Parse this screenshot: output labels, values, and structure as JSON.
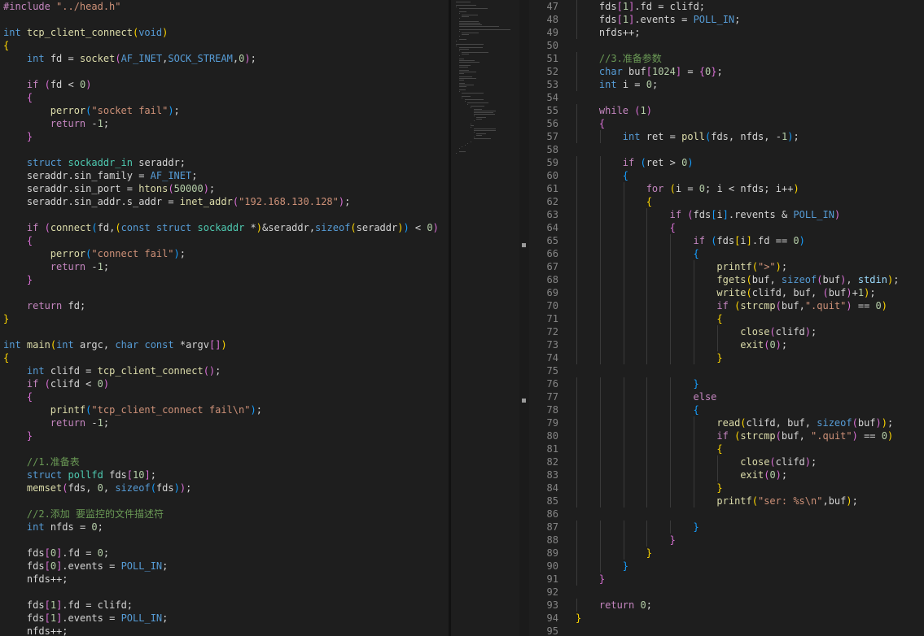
{
  "left_editor": {
    "lines": [
      "#include \"../head.h\"",
      "",
      "int tcp_client_connect(void)",
      "{",
      "    int fd = socket(AF_INET,SOCK_STREAM,0);",
      "",
      "    if (fd < 0)",
      "    {",
      "        perror(\"socket fail\");",
      "        return -1;",
      "    }",
      "",
      "    struct sockaddr_in seraddr;",
      "    seraddr.sin_family = AF_INET;",
      "    seraddr.sin_port = htons(50000);",
      "    seraddr.sin_addr.s_addr = inet_addr(\"192.168.130.128\");",
      "",
      "    if (connect(fd,(const struct sockaddr *)&seraddr,sizeof(seraddr)) < 0)",
      "    {",
      "        perror(\"connect fail\");",
      "        return -1;",
      "    }",
      "",
      "    return fd;",
      "}",
      "",
      "int main(int argc, char const *argv[])",
      "{",
      "    int clifd = tcp_client_connect();",
      "    if (clifd < 0)",
      "    {",
      "        printf(\"tcp_client_connect fail\\n\");",
      "        return -1;",
      "    }",
      "",
      "    //1.准备表",
      "    struct pollfd fds[10];",
      "    memset(fds, 0, sizeof(fds));",
      "",
      "    //2.添加 要监控的文件描述符",
      "    int nfds = 0;",
      "",
      "    fds[0].fd = 0;",
      "    fds[0].events = POLL_IN;",
      "    nfds++;",
      "",
      "    fds[1].fd = clifd;",
      "    fds[1].events = POLL_IN;",
      "    nfds++;"
    ]
  },
  "right_editor": {
    "line_numbers": [
      "47",
      "48",
      "49",
      "50",
      "51",
      "52",
      "53",
      "54",
      "55",
      "56",
      "57",
      "58",
      "59",
      "60",
      "61",
      "62",
      "63",
      "64",
      "65",
      "66",
      "67",
      "68",
      "69",
      "70",
      "71",
      "72",
      "73",
      "74",
      "75",
      "76",
      "77",
      "78",
      "79",
      "80",
      "81",
      "82",
      "83",
      "84",
      "85",
      "86",
      "87",
      "88",
      "89",
      "90",
      "91",
      "92",
      "93",
      "94",
      "95"
    ],
    "lines": [
      "    fds[1].fd = clifd;",
      "    fds[1].events = POLL_IN;",
      "    nfds++;",
      "",
      "    //3.准备参数",
      "    char buf[1024] = {0};",
      "    int i = 0;",
      "",
      "    while (1)",
      "    {",
      "        int ret = poll(fds, nfds, -1);",
      "",
      "        if (ret > 0)",
      "        {",
      "            for (i = 0; i < nfds; i++)",
      "            {",
      "                if (fds[i].revents & POLL_IN)",
      "                {",
      "                    if (fds[i].fd == 0)",
      "                    {",
      "                        printf(\">\");",
      "                        fgets(buf, sizeof(buf), stdin);",
      "                        write(clifd, buf, (buf)+1);",
      "                        if (strcmp(buf,\".quit\") == 0)",
      "                        {",
      "                            close(clifd);",
      "                            exit(0);",
      "                        }",
      "",
      "                    }",
      "                    else",
      "                    {",
      "                        read(clifd, buf, sizeof(buf));",
      "                        if (strcmp(buf, \".quit\") == 0)",
      "                        {",
      "                            close(clifd);",
      "                            exit(0);",
      "                        }",
      "                        printf(\"ser: %s\\n\",buf);",
      "",
      "                    }",
      "                }",
      "            }",
      "        }",
      "    }",
      "",
      "    return 0;",
      "}",
      ""
    ]
  },
  "colors": {
    "background": "#1e1e1e",
    "keyword": "#569cd6",
    "control": "#c586c0",
    "function": "#dcdcaa",
    "string": "#ce9178",
    "number": "#b5cea8",
    "macro": "#4ec9b0",
    "variable": "#9cdcfe",
    "comment": "#6a9955",
    "line_number": "#858585"
  }
}
